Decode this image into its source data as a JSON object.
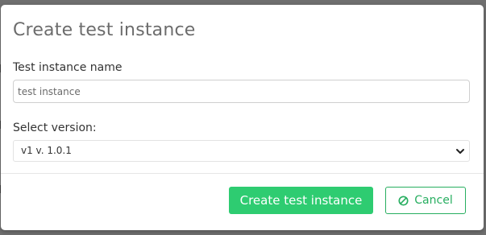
{
  "modal": {
    "title": "Create test instance"
  },
  "form": {
    "name_label": "Test instance name",
    "name_value": "",
    "name_placeholder": "test instance",
    "version_label": "Select version:",
    "version_selected": "v1 v. 1.0.1"
  },
  "footer": {
    "create_label": "Create test instance",
    "cancel_label": "Cancel",
    "cancel_icon": "ban-icon"
  },
  "colors": {
    "accent": "#2ecc71",
    "accent_dark": "#27ae60",
    "title": "#6c6c6c"
  }
}
